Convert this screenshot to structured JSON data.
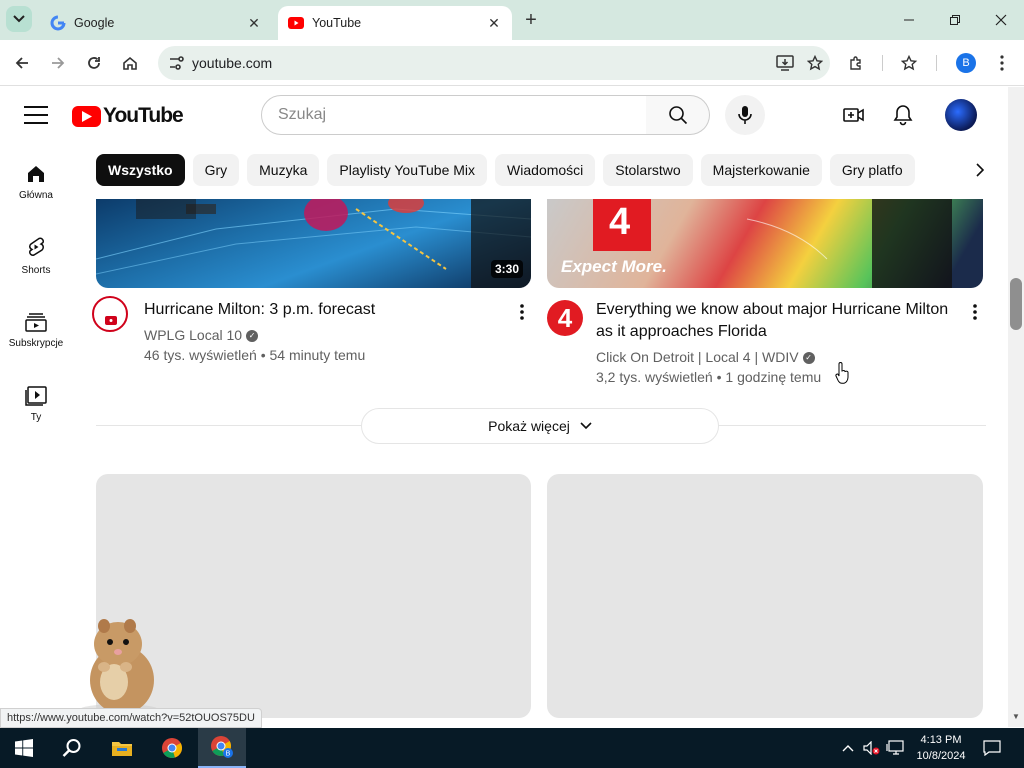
{
  "browser": {
    "tabs": [
      {
        "title": "Google",
        "icon": "google-icon",
        "active": false
      },
      {
        "title": "YouTube",
        "icon": "youtube-icon",
        "active": true
      }
    ],
    "new_tab_label": "+",
    "url": "youtube.com",
    "profile_initial": "B",
    "status_url": "https://www.youtube.com/watch?v=52tOUOS75DU"
  },
  "youtube": {
    "logo_text": "YouTube",
    "search_placeholder": "Szukaj",
    "chips": [
      "Wszystko",
      "Gry",
      "Muzyka",
      "Playlisty YouTube Mix",
      "Wiadomości",
      "Stolarstwo",
      "Majsterkowanie",
      "Gry platfo"
    ],
    "sidebar": [
      {
        "label": "Główna",
        "icon": "home-icon"
      },
      {
        "label": "Shorts",
        "icon": "shorts-icon"
      },
      {
        "label": "Subskrypcje",
        "icon": "subscriptions-icon"
      },
      {
        "label": "Ty",
        "icon": "you-icon"
      }
    ],
    "videos": [
      {
        "title": "Hurricane Milton: 3 p.m. forecast",
        "channel": "WPLG Local 10",
        "views": "46 tys. wyświetleń",
        "age": "54 minuty temu",
        "duration": "3:30",
        "channel_color": "#d0021b"
      },
      {
        "title_line1": "Everything we know about major Hurricane Milton",
        "title_line2": "as it approaches Florida",
        "channel": "Click On Detroit | Local 4 | WDIV",
        "views": "3,2 tys. wyświetleń",
        "age": "1 godzinę temu",
        "channel_color": "#e11b22",
        "thumb_text": "Expect More.",
        "thumb_badge": "4"
      }
    ],
    "show_more": "Pokaż więcej"
  },
  "taskbar": {
    "time": "4:13 PM",
    "date": "10/8/2024"
  }
}
